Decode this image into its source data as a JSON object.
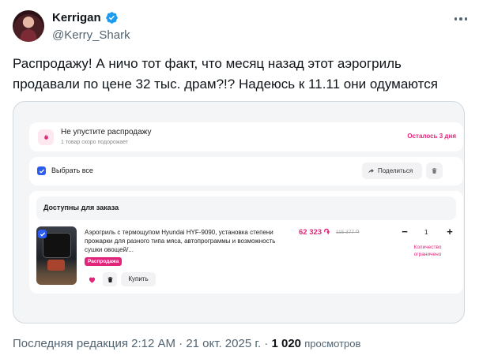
{
  "author": {
    "display_name": "Kerrigan",
    "handle": "@Kerry_Shark"
  },
  "tweet": {
    "text": "Распродажу! А ничо тот факт, что месяц назад этот аэрогриль продавали по цене 32 тыс. драм?!? Надеюсь к 11.11 они одумаются"
  },
  "screenshot": {
    "promo": {
      "title": "Не упустите распродажу",
      "subtitle": "1 товар скоро подорожает",
      "time_left": "Осталось 3 дня"
    },
    "toolbar": {
      "select_all_label": "Выбрать все",
      "share_label": "Поделиться"
    },
    "section_title": "Доступны для заказа",
    "item": {
      "description": "Аэрогриль с термощупом Hyundai HYF-9090, установка степени прожарки для разного типа мяса, автопрограммы и возможность сушки овощей/...",
      "tag": "Распродажа",
      "price": "62 323 ֏",
      "old_price": "115 377 ֏",
      "quantity": "1",
      "limit_note": "Количество ограничено",
      "buy_label": "Купить"
    }
  },
  "footer": {
    "edited": "Последняя редакция 2:12 AM",
    "date": "21 окт. 2025 г.",
    "views_count": "1 020",
    "views_label": "просмотров"
  },
  "colors": {
    "accent_pink": "#e0267a",
    "checkbox_blue": "#2c5cf0",
    "verified_blue": "#1d9bf0"
  }
}
